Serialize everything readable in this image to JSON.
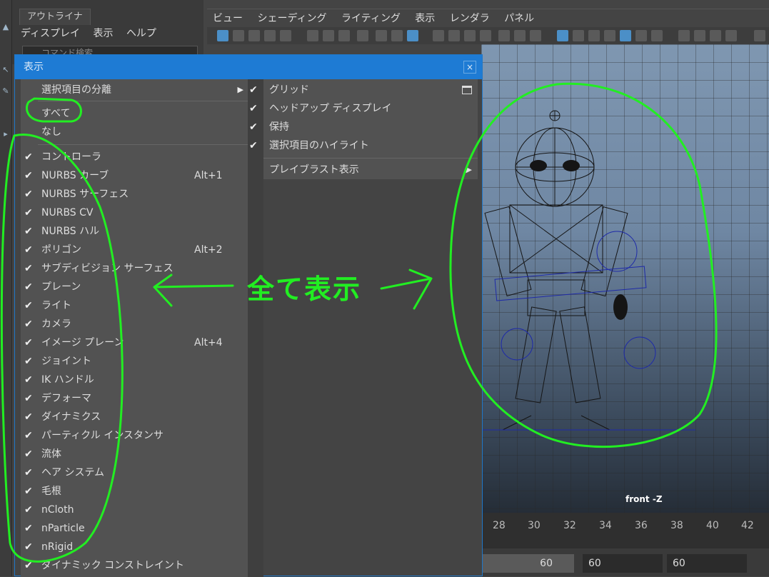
{
  "outliner": {
    "tab": "アウトライナ",
    "menus": [
      "ディスプレイ",
      "表示",
      "ヘルプ"
    ],
    "search_placeholder": "コマンド検索"
  },
  "panel": {
    "menus": [
      "ビュー",
      "シェーディング",
      "ライティング",
      "表示",
      "レンダラ",
      "パネル"
    ],
    "camera_label": "front -Z"
  },
  "timeline": {
    "ticks": [
      "28",
      "30",
      "32",
      "34",
      "36",
      "38",
      "40",
      "42"
    ]
  },
  "range": {
    "field1": "60",
    "field2": "60",
    "field3": "60"
  },
  "dialog": {
    "title": "表示",
    "close": "×",
    "top_items": [
      {
        "label": "選択項目の分離",
        "submenu": true
      },
      {
        "label": "すべて"
      },
      {
        "label": "なし"
      }
    ],
    "check_items": [
      {
        "label": "コントローラ",
        "shortcut": ""
      },
      {
        "label": "NURBS カーブ",
        "shortcut": "Alt+1"
      },
      {
        "label": "NURBS サーフェス",
        "shortcut": ""
      },
      {
        "label": "NURBS CV",
        "shortcut": ""
      },
      {
        "label": "NURBS ハル",
        "shortcut": ""
      },
      {
        "label": "ポリゴン",
        "shortcut": "Alt+2"
      },
      {
        "label": "サブディビジョン サーフェス",
        "shortcut": ""
      },
      {
        "label": "プレーン",
        "shortcut": ""
      },
      {
        "label": "ライト",
        "shortcut": ""
      },
      {
        "label": "カメラ",
        "shortcut": ""
      },
      {
        "label": "イメージ プレーン",
        "shortcut": "Alt+4"
      },
      {
        "label": "ジョイント",
        "shortcut": ""
      },
      {
        "label": "IK ハンドル",
        "shortcut": ""
      },
      {
        "label": "デフォーマ",
        "shortcut": ""
      },
      {
        "label": "ダイナミクス",
        "shortcut": ""
      },
      {
        "label": "パーティクル インスタンサ",
        "shortcut": ""
      },
      {
        "label": "流体",
        "shortcut": ""
      },
      {
        "label": "ヘア システム",
        "shortcut": ""
      },
      {
        "label": "毛根",
        "shortcut": ""
      },
      {
        "label": "nCloth",
        "shortcut": ""
      },
      {
        "label": "nParticle",
        "shortcut": ""
      },
      {
        "label": "nRigid",
        "shortcut": ""
      },
      {
        "label": "ダイナミック コンストレイント",
        "shortcut": ""
      }
    ],
    "right_items": [
      {
        "label": "グリッド",
        "checked": true
      },
      {
        "label": "ヘッドアップ ディスプレイ",
        "checked": true
      },
      {
        "label": "保持",
        "checked": true
      },
      {
        "label": "選択項目のハイライト",
        "checked": true
      },
      {
        "label": "プレイブラスト表示",
        "checked": false,
        "submenu": true
      }
    ]
  },
  "annotation": {
    "text": "全て表示",
    "color": "#22ee22"
  },
  "colors": {
    "title_bar": "#1e7bd4",
    "menu_bg": "#525252",
    "accent": "#4b8fc7"
  }
}
